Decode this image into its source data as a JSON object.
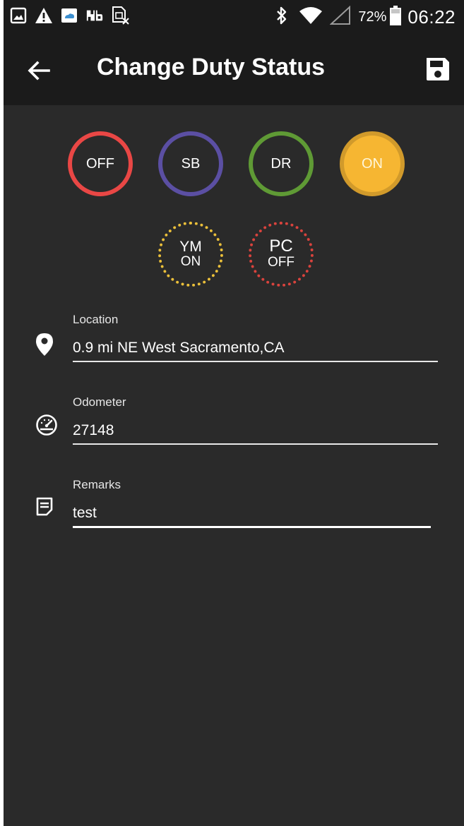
{
  "status_bar": {
    "battery_percent": "72%",
    "time": "06:22",
    "left_icons": [
      "image-icon",
      "warning-icon",
      "weather-icon",
      "app-icon",
      "sim-card-icon"
    ],
    "right_icons": [
      "bluetooth-icon",
      "wifi-icon",
      "signal-icon",
      "battery-icon"
    ]
  },
  "app_bar": {
    "title": "Change Duty Status",
    "back_icon": "arrow-back-icon",
    "save_icon": "save-icon"
  },
  "duty_status": {
    "buttons": [
      {
        "id": "off",
        "label": "OFF",
        "color": "#e94745",
        "selected": false
      },
      {
        "id": "sb",
        "label": "SB",
        "color": "#5b4fa3",
        "selected": false
      },
      {
        "id": "dr",
        "label": "DR",
        "color": "#5f9a35",
        "selected": false
      },
      {
        "id": "on",
        "label": "ON",
        "color": "#f6b632",
        "selected": true
      }
    ],
    "special": [
      {
        "id": "ym",
        "line1": "YM",
        "line2": "ON",
        "color": "#eabf3a"
      },
      {
        "id": "pc",
        "line1": "PC",
        "line2": "OFF",
        "color": "#d9433d"
      }
    ]
  },
  "form": {
    "location": {
      "label": "Location",
      "value": "0.9 mi NE West Sacramento,CA",
      "icon": "location-pin-icon"
    },
    "odometer": {
      "label": "Odometer",
      "value": "27148",
      "icon": "speedometer-icon"
    },
    "remarks": {
      "label": "Remarks",
      "value": "test",
      "icon": "note-icon"
    }
  },
  "colors": {
    "background": "#2a2a2a",
    "bar": "#1b1b1b",
    "accent_on": "#f6b632"
  }
}
